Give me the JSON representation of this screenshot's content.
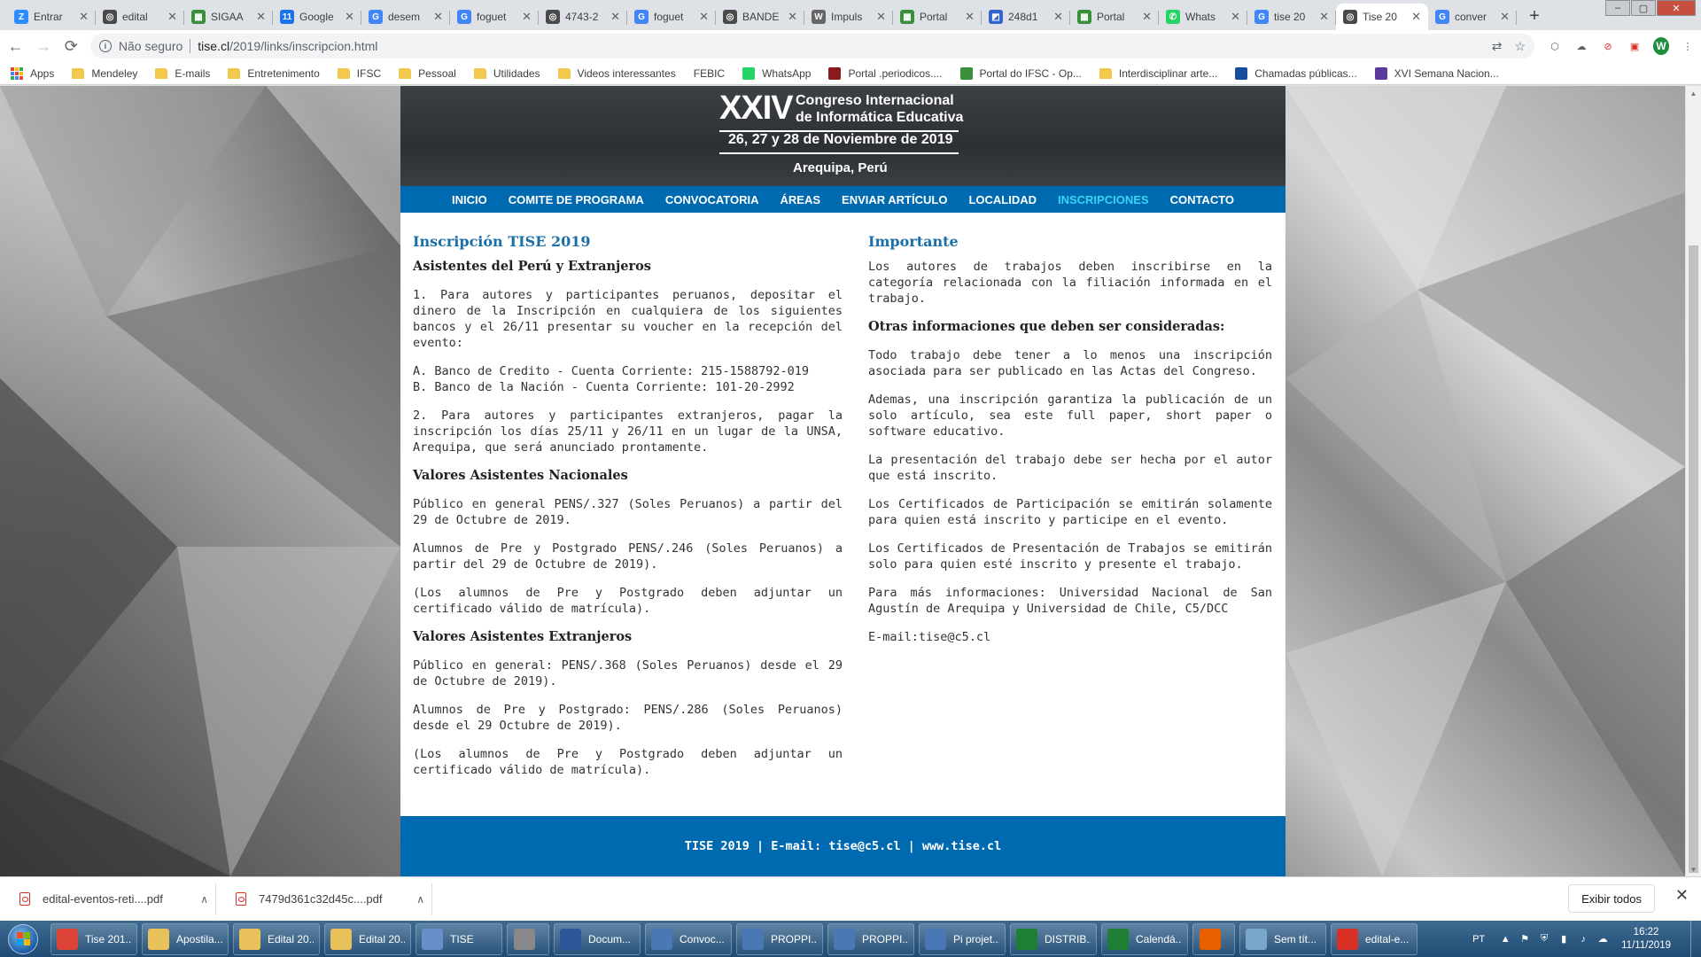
{
  "browser": {
    "tabs": [
      {
        "title": "Entrar",
        "icon_letter": "Z",
        "icon_color": "#2d8cff"
      },
      {
        "title": "edital",
        "icon_letter": "◎",
        "icon_color": "#4a4a4a"
      },
      {
        "title": "SIGAA",
        "icon_letter": "▦",
        "icon_color": "#3a8f3a"
      },
      {
        "title": "Google",
        "icon_letter": "11",
        "icon_color": "#1a73e8"
      },
      {
        "title": "desem",
        "icon_letter": "G",
        "icon_color": "#4285f4"
      },
      {
        "title": "foguet",
        "icon_letter": "G",
        "icon_color": "#4285f4"
      },
      {
        "title": "4743-2",
        "icon_letter": "◎",
        "icon_color": "#4a4a4a"
      },
      {
        "title": "foguet",
        "icon_letter": "G",
        "icon_color": "#4285f4"
      },
      {
        "title": "BANDE",
        "icon_letter": "◎",
        "icon_color": "#4a4a4a"
      },
      {
        "title": "Impuls",
        "icon_letter": "W",
        "icon_color": "#666666"
      },
      {
        "title": "Portal",
        "icon_letter": "▦",
        "icon_color": "#3a8f3a"
      },
      {
        "title": "248d1",
        "icon_letter": "◩",
        "icon_color": "#3366cc"
      },
      {
        "title": "Portal",
        "icon_letter": "▦",
        "icon_color": "#3a8f3a"
      },
      {
        "title": "Whats",
        "icon_letter": "✆",
        "icon_color": "#25d366"
      },
      {
        "title": "tise 20",
        "icon_letter": "G",
        "icon_color": "#4285f4"
      },
      {
        "title": "Tise 20",
        "icon_letter": "◎",
        "icon_color": "#4a4a4a",
        "active": true
      },
      {
        "title": "conver",
        "icon_letter": "G",
        "icon_color": "#4285f4"
      }
    ],
    "new_tab": "+",
    "window_controls": {
      "minimize": "–",
      "maximize": "▢",
      "close": "✕"
    },
    "nav": {
      "back": "←",
      "forward": "→",
      "reload": "⟳"
    },
    "omnibox": {
      "security_text": "Não seguro",
      "url_host": "tise.cl",
      "url_path": "/2019/links/inscripcion.html"
    },
    "profile_letter": "W",
    "bookmarks": [
      {
        "label": "Apps",
        "icon": "apps-icon"
      },
      {
        "label": "Mendeley",
        "icon": "folder-icon"
      },
      {
        "label": "E-mails",
        "icon": "folder-icon"
      },
      {
        "label": "Entretenimento",
        "icon": "folder-icon"
      },
      {
        "label": "IFSC",
        "icon": "folder-icon"
      },
      {
        "label": "Pessoal",
        "icon": "folder-icon"
      },
      {
        "label": "Utilidades",
        "icon": "folder-icon"
      },
      {
        "label": "Videos interessantes",
        "icon": "folder-icon"
      },
      {
        "label": "FEBIC",
        "icon": "none"
      },
      {
        "label": "WhatsApp",
        "icon": "whatsapp-icon"
      },
      {
        "label": "Portal .periodicos....",
        "icon": "periodicos-icon"
      },
      {
        "label": "Portal do IFSC - Op...",
        "icon": "ifsc-icon"
      },
      {
        "label": "Interdisciplinar arte...",
        "icon": "folder-icon"
      },
      {
        "label": "Chamadas públicas...",
        "icon": "chamadas-icon"
      },
      {
        "label": "XVI Semana Nacion...",
        "icon": "semana-icon"
      }
    ]
  },
  "page": {
    "banner": {
      "roman": "XXIV",
      "line1": "Congreso Internacional",
      "line2": "de Informática Educativa",
      "dates": "26, 27 y 28 de Noviembre de 2019",
      "city": "Arequipa, Perú"
    },
    "nav": [
      "INICIO",
      "COMITE DE PROGRAMA",
      "CONVOCATORIA",
      "ÁREAS",
      "ENVIAR ARTÍCULO",
      "LOCALIDAD",
      "INSCRIPCIONES",
      "CONTACTO"
    ],
    "left": {
      "title": "Inscripción TISE 2019",
      "subtitle": "Asistentes del Perú y Extranjeros",
      "p1": "1. Para autores y participantes peruanos, depositar el dinero de la Inscripción en cualquiera de los siguientes bancos y el 26/11 presentar su voucher en la recepción del evento:",
      "bank_a": "A. Banco de Credito - Cuenta Corriente: 215-1588792-019",
      "bank_b": "B. Banco de la Nación - Cuenta Corriente: 101-20-2992",
      "p2": "2. Para autores y participantes extranjeros, pagar la inscripción los días 25/11 y 26/11 en un lugar de la UNSA, Arequipa, que será anunciado prontamente.",
      "nac_title": "Valores Asistentes Nacionales",
      "nac_p1": "Público en general PENS/.327 (Soles Peruanos) a partir del 29 de Octubre de 2019.",
      "nac_p2": "Alumnos de Pre y Postgrado PENS/.246 (Soles Peruanos) a partir del 29 de Octubre de 2019).",
      "nac_p3": "(Los alumnos de Pre y Postgrado deben adjuntar un certificado válido de matrícula).",
      "ext_title": "Valores Asistentes Extranjeros",
      "ext_p1": "Público en general: PENS/.368 (Soles Peruanos) desde el 29 de Octubre de 2019).",
      "ext_p2": "Alumnos de Pre y Postgrado: PENS/.286 (Soles Peruanos) desde el 29 Octubre de 2019).",
      "ext_p3": "(Los alumnos de Pre y Postgrado deben adjuntar un certificado válido de matrícula)."
    },
    "right": {
      "title": "Importante",
      "p1": "Los autores de trabajos deben inscribirse en la categoría relacionada con la filiación informada en el trabajo.",
      "subtitle": "Otras informaciones que deben ser consideradas:",
      "p2": "Todo trabajo debe tener a lo menos una inscripción asociada para ser publicado en las Actas del Congreso.",
      "p3": "Ademas, una inscripción garantiza la publicación de un solo artículo, sea este full paper, short paper o software educativo.",
      "p4": "La presentación del trabajo debe ser hecha por el autor que está inscrito.",
      "p5": "Los Certificados de Participación se emitirán solamente para quien está inscrito y participe en el evento.",
      "p6": "Los Certificados de Presentación de Trabajos se emitirán solo para quien esté inscrito y presente el trabajo.",
      "p7": "Para más informaciones: Universidad Nacional de San Agustín de Arequipa y Universidad de Chile, C5/DCC",
      "email": "E-mail:tise@c5.cl"
    },
    "footer": "TISE 2019 | E-mail: tise@c5.cl | www.tise.cl"
  },
  "downloads": {
    "items": [
      "edital-eventos-reti....pdf",
      "7479d361c32d45c....pdf"
    ],
    "show_all": "Exibir todos",
    "close": "✕"
  },
  "taskbar": {
    "tasks": [
      {
        "label": "Tise 201...",
        "icon": "chrome-icon",
        "color": "#db4437"
      },
      {
        "label": "Apostila...",
        "icon": "folder-icon",
        "color": "#e8c15a"
      },
      {
        "label": "Edital 20...",
        "icon": "folder-icon",
        "color": "#e8c15a"
      },
      {
        "label": "Edital 20...",
        "icon": "folder-icon",
        "color": "#e8c15a"
      },
      {
        "label": "TISE",
        "icon": "contacts-icon",
        "color": "#6a8fc8"
      },
      {
        "label": "",
        "icon": "settings-icon",
        "color": "#888888"
      },
      {
        "label": "Docum...",
        "icon": "word-icon",
        "color": "#2b579a"
      },
      {
        "label": "Convoc...",
        "icon": "writer-icon",
        "color": "#4a78b5"
      },
      {
        "label": "PROPPI...",
        "icon": "writer-icon",
        "color": "#4a78b5"
      },
      {
        "label": "PROPPI...",
        "icon": "writer-icon",
        "color": "#4a78b5"
      },
      {
        "label": "Pi projet...",
        "icon": "writer-icon",
        "color": "#4a78b5"
      },
      {
        "label": "DISTRIB...",
        "icon": "calc-icon",
        "color": "#1e7e34"
      },
      {
        "label": "Calendá...",
        "icon": "calc-icon",
        "color": "#1e7e34"
      },
      {
        "label": "",
        "icon": "firefox-icon",
        "color": "#e66000"
      },
      {
        "label": "Sem tít...",
        "icon": "notepad-icon",
        "color": "#7aa6c9"
      },
      {
        "label": "edital-e...",
        "icon": "pdf-icon",
        "color": "#d93025"
      }
    ],
    "lang": "PT",
    "time": "16:22",
    "date": "11/11/2019"
  }
}
